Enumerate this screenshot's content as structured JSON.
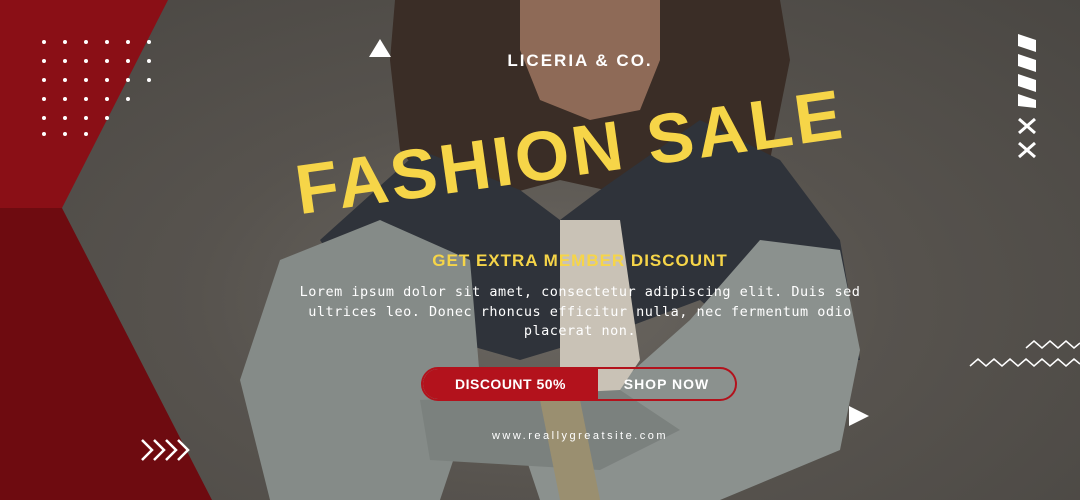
{
  "brand": {
    "name": "LICERIA & CO."
  },
  "hero": {
    "title": "FASHION SALE",
    "subtitle": "GET EXTRA MEMBER DISCOUNT",
    "body": "Lorem ipsum dolor sit amet, consectetur adipiscing elit. Duis sed ultrices leo. Donec rhoncus efficitur nulla, nec fermentum odio placerat non."
  },
  "cta": {
    "discount_label": "DISCOUNT 50%",
    "shop_label": "SHOP NOW"
  },
  "footer": {
    "website": "www.reallygreatsite.com"
  },
  "colors": {
    "accent_red": "#b3121c",
    "dark_red": "#7d0d12",
    "title_yellow": "#f6d548",
    "background": "#55514c"
  },
  "icons": [
    "dot-grid-pattern",
    "triangle-icon",
    "double-chevron-arrows-icon",
    "stripes-pattern",
    "cross-icon",
    "zigzag-pattern"
  ]
}
